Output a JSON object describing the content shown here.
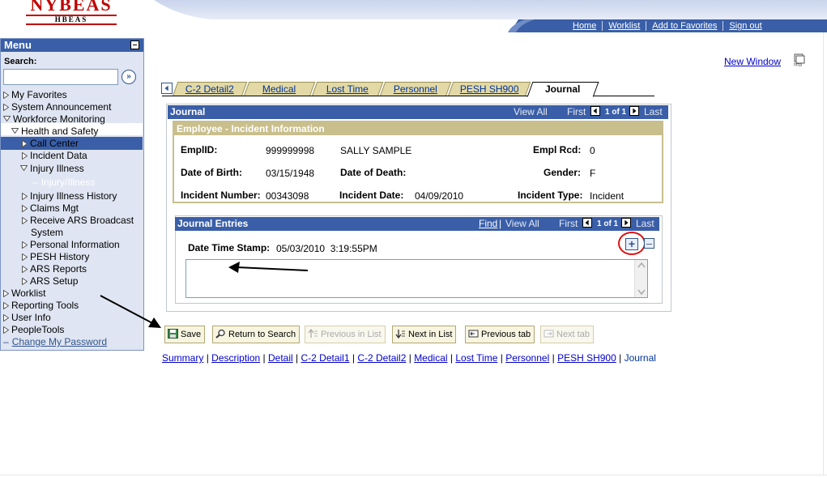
{
  "brand": {
    "logo_main": "NYBEAS",
    "logo_sub": "HBEAS"
  },
  "topnav": [
    {
      "label": "Home"
    },
    {
      "label": "Worklist"
    },
    {
      "label": "Add to Favorites"
    },
    {
      "label": "Sign out"
    }
  ],
  "menu": {
    "title": "Menu",
    "search_label": "Search:",
    "search_value": "",
    "items": [
      {
        "label": "My Favorites"
      },
      {
        "label": "System Announcement"
      },
      {
        "label": "Workforce Monitoring"
      },
      {
        "label": "Health and Safety"
      },
      {
        "label": "Call Center"
      },
      {
        "label": "Incident Data"
      },
      {
        "label": "Injury Illness"
      },
      {
        "label": "Injury/Illness"
      },
      {
        "label": "Injury Illness History"
      },
      {
        "label": "Claims Mgt"
      },
      {
        "label": "Receive ARS Broadcast"
      },
      {
        "label": "System"
      },
      {
        "label": "Personal Information"
      },
      {
        "label": "PESH History"
      },
      {
        "label": "ARS Reports"
      },
      {
        "label": "ARS Setup"
      },
      {
        "label": "Worklist"
      },
      {
        "label": "Reporting Tools"
      },
      {
        "label": "User Info"
      },
      {
        "label": "PeopleTools"
      },
      {
        "label": "Change My Password"
      }
    ]
  },
  "new_window": "New Window",
  "tabs": [
    {
      "label": "C-2 Detail2"
    },
    {
      "label": "Medical"
    },
    {
      "label": "Lost Time"
    },
    {
      "label": "Personnel"
    },
    {
      "label": "PESH SH900"
    },
    {
      "label": "Journal"
    }
  ],
  "journal": {
    "title": "Journal",
    "view_all": "View All",
    "first": "First",
    "count": "1 of 1",
    "last": "Last"
  },
  "employee": {
    "title": "Employee - Incident Information",
    "emplid_label": "EmplID:",
    "emplid": "999999998",
    "name": "SALLY SAMPLE",
    "empl_rcd_label": "Empl Rcd:",
    "empl_rcd": "0",
    "dob_label": "Date of Birth:",
    "dob": "03/15/1948",
    "dod_label": "Date of Death:",
    "dod": "",
    "gender_label": "Gender:",
    "gender": "F",
    "incident_num_label": "Incident Number:",
    "incident_num": "00343098",
    "incident_date_label": "Incident Date:",
    "incident_date": "04/09/2010",
    "incident_type_label": "Incident Type:",
    "incident_type": "Incident"
  },
  "journal_entries": {
    "title": "Journal Entries",
    "find": "Find",
    "view_all": "View All",
    "first": "First",
    "count": "1 of 1",
    "last": "Last",
    "timestamp_label": "Date Time Stamp:",
    "timestamp": "05/03/2010  3:19:55PM",
    "text": ""
  },
  "toolbar": {
    "save": "Save",
    "return_to_search": "Return to Search",
    "previous_in_list": "Previous in List",
    "next_in_list": "Next in List",
    "previous_tab": "Previous tab",
    "next_tab": "Next tab"
  },
  "bottom_links": [
    {
      "label": "Summary"
    },
    {
      "label": "Description"
    },
    {
      "label": "Detail"
    },
    {
      "label": "C-2 Detail1"
    },
    {
      "label": "C-2 Detail2"
    },
    {
      "label": "Medical"
    },
    {
      "label": "Lost Time"
    },
    {
      "label": "Personnel"
    },
    {
      "label": "PESH SH900"
    },
    {
      "label": "Journal"
    }
  ],
  "colors": {
    "header_blue": "#3a5fa8",
    "tab_tan": "#e2d9a6",
    "panel_tan": "#c8bf8d",
    "logo_red": "#c00000",
    "annotation_red": "#dd1111"
  }
}
